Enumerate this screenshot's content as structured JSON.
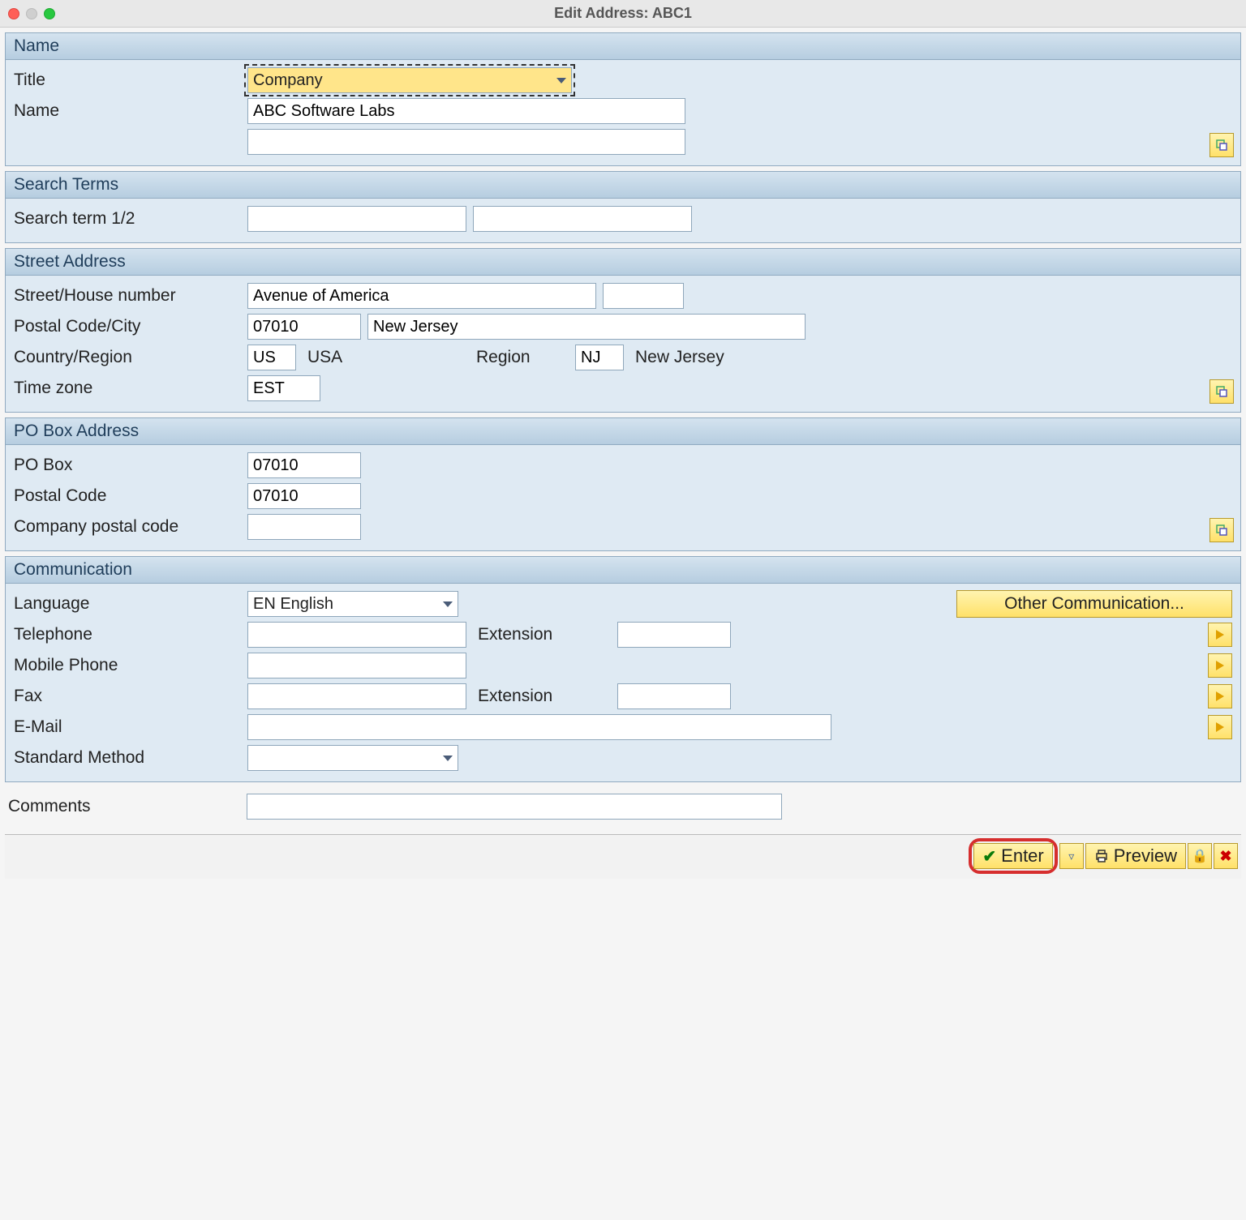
{
  "window": {
    "title": "Edit Address:  ABC1"
  },
  "sections": {
    "name": {
      "header": "Name",
      "title_label": "Title",
      "title_value": "Company",
      "name_label": "Name",
      "name_value": "ABC Software Labs",
      "name2_value": ""
    },
    "search": {
      "header": "Search Terms",
      "label": "Search term 1/2",
      "term1": "",
      "term2": ""
    },
    "street": {
      "header": "Street Address",
      "street_label": "Street/House number",
      "street_value": "Avenue of America",
      "house_value": "",
      "postal_label": "Postal Code/City",
      "postal_value": "07010",
      "city_value": "New Jersey",
      "country_label": "Country/Region",
      "country_code": "US",
      "country_name": "USA",
      "region_label": "Region",
      "region_code": "NJ",
      "region_name": "New Jersey",
      "tz_label": "Time zone",
      "tz_value": "EST"
    },
    "pobox": {
      "header": "PO Box Address",
      "po_label": "PO Box",
      "po_value": "07010",
      "postal_label": "Postal Code",
      "postal_value": "07010",
      "company_postal_label": "Company postal code",
      "company_postal_value": ""
    },
    "comm": {
      "header": "Communication",
      "lang_label": "Language",
      "lang_value": "EN  English",
      "other_btn": "Other Communication...",
      "tel_label": "Telephone",
      "tel_value": "",
      "ext_label": "Extension",
      "tel_ext": "",
      "mobile_label": "Mobile Phone",
      "mobile_value": "",
      "fax_label": "Fax",
      "fax_value": "",
      "fax_ext": "",
      "email_label": "E-Mail",
      "email_value": "",
      "std_label": "Standard Method",
      "std_value": ""
    }
  },
  "comments": {
    "label": "Comments",
    "value": ""
  },
  "footer": {
    "enter": "Enter",
    "preview": "Preview"
  }
}
